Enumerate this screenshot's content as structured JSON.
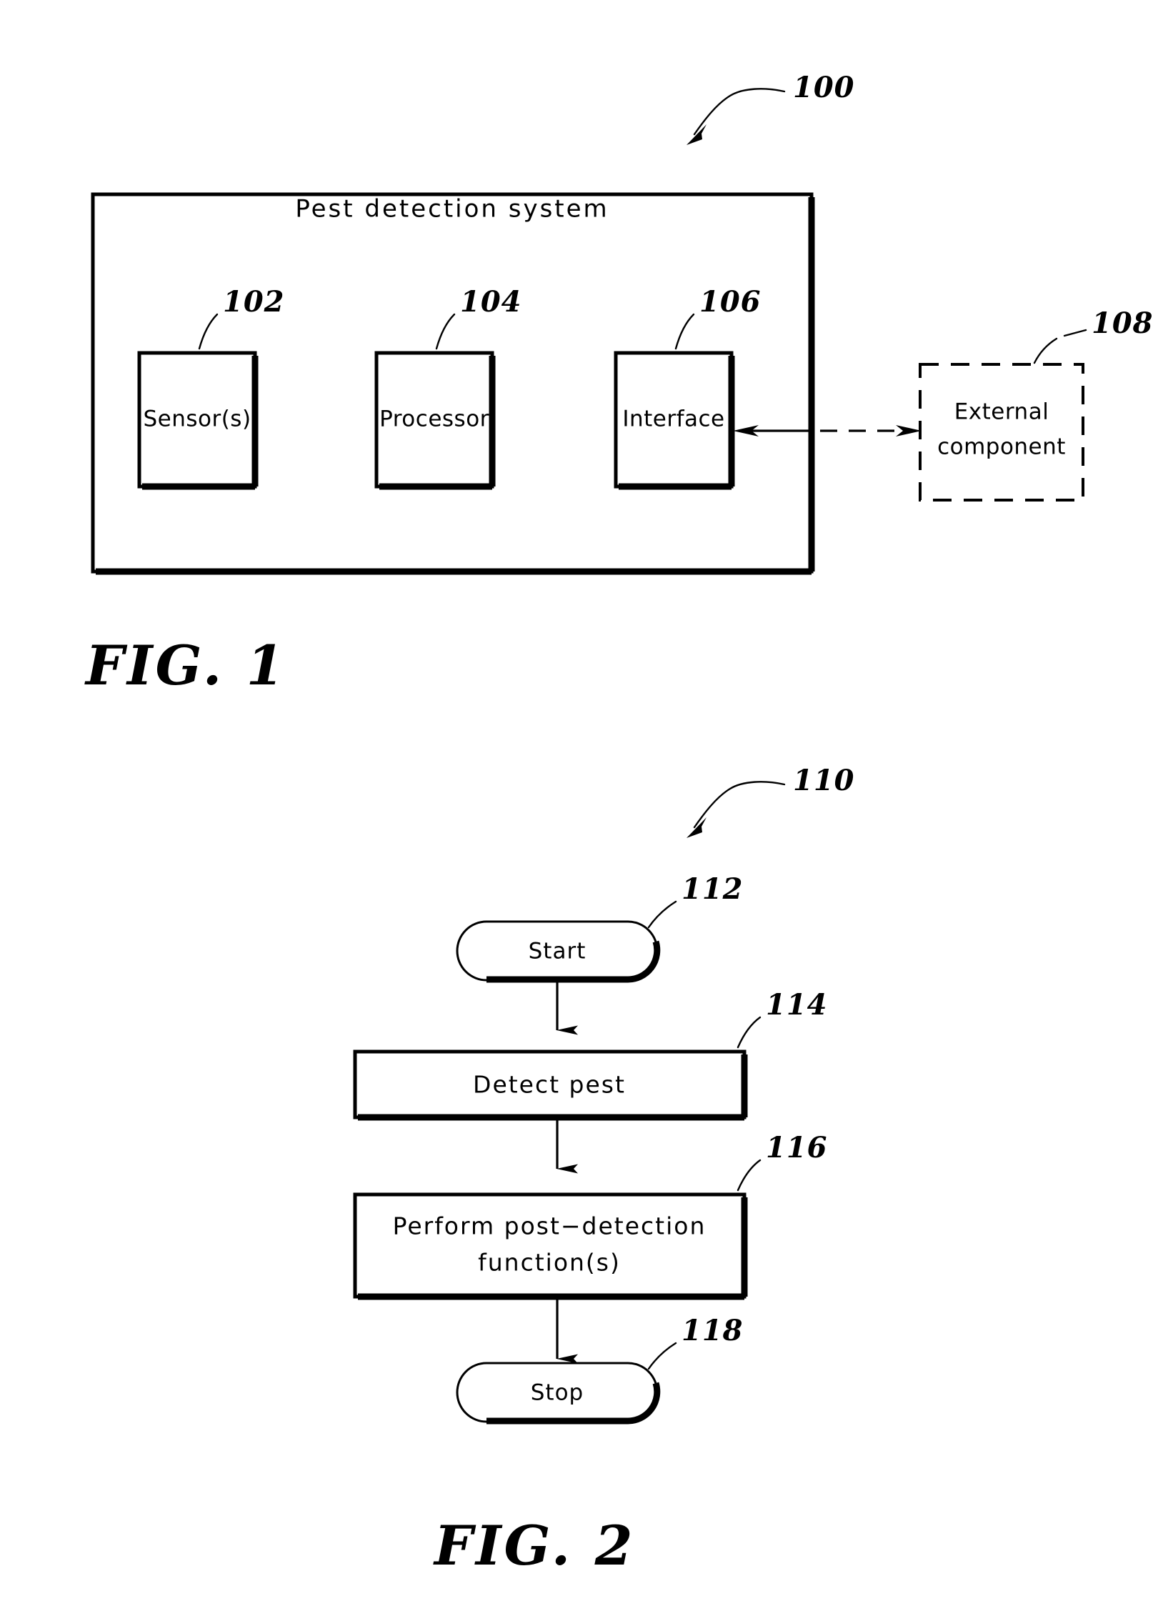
{
  "document": {
    "kind": "patent-drawing-sheet",
    "background_color": "#ffffff",
    "ink_color": "#000000"
  },
  "figure1": {
    "caption": "FIG.  1",
    "reference_numeral": "100",
    "system_box": {
      "title": "Pest detection system",
      "reference_numeral": "100"
    },
    "components": [
      {
        "label": "Sensor(s)",
        "reference_numeral": "102",
        "style": "solid"
      },
      {
        "label": "Processor",
        "reference_numeral": "104",
        "style": "solid"
      },
      {
        "label": "Interface",
        "reference_numeral": "106",
        "style": "solid"
      }
    ],
    "external": {
      "label_line1": "External",
      "label_line2": "component",
      "reference_numeral": "108",
      "style": "dashed"
    },
    "connection": {
      "from": "Interface",
      "to": "External component",
      "direction": "bidirectional",
      "line_style": "solid-then-dashed"
    }
  },
  "figure2": {
    "caption": "FIG.  2",
    "reference_numeral": "110",
    "steps": [
      {
        "label": "Start",
        "reference_numeral": "112",
        "shape": "pill"
      },
      {
        "label": "Detect pest",
        "reference_numeral": "114",
        "shape": "rect"
      },
      {
        "label_line1": "Perform  post−detection",
        "label_line2": "function(s)",
        "reference_numeral": "116",
        "shape": "rect"
      },
      {
        "label": "Stop",
        "reference_numeral": "118",
        "shape": "pill"
      }
    ],
    "flow_arrows": 3
  }
}
